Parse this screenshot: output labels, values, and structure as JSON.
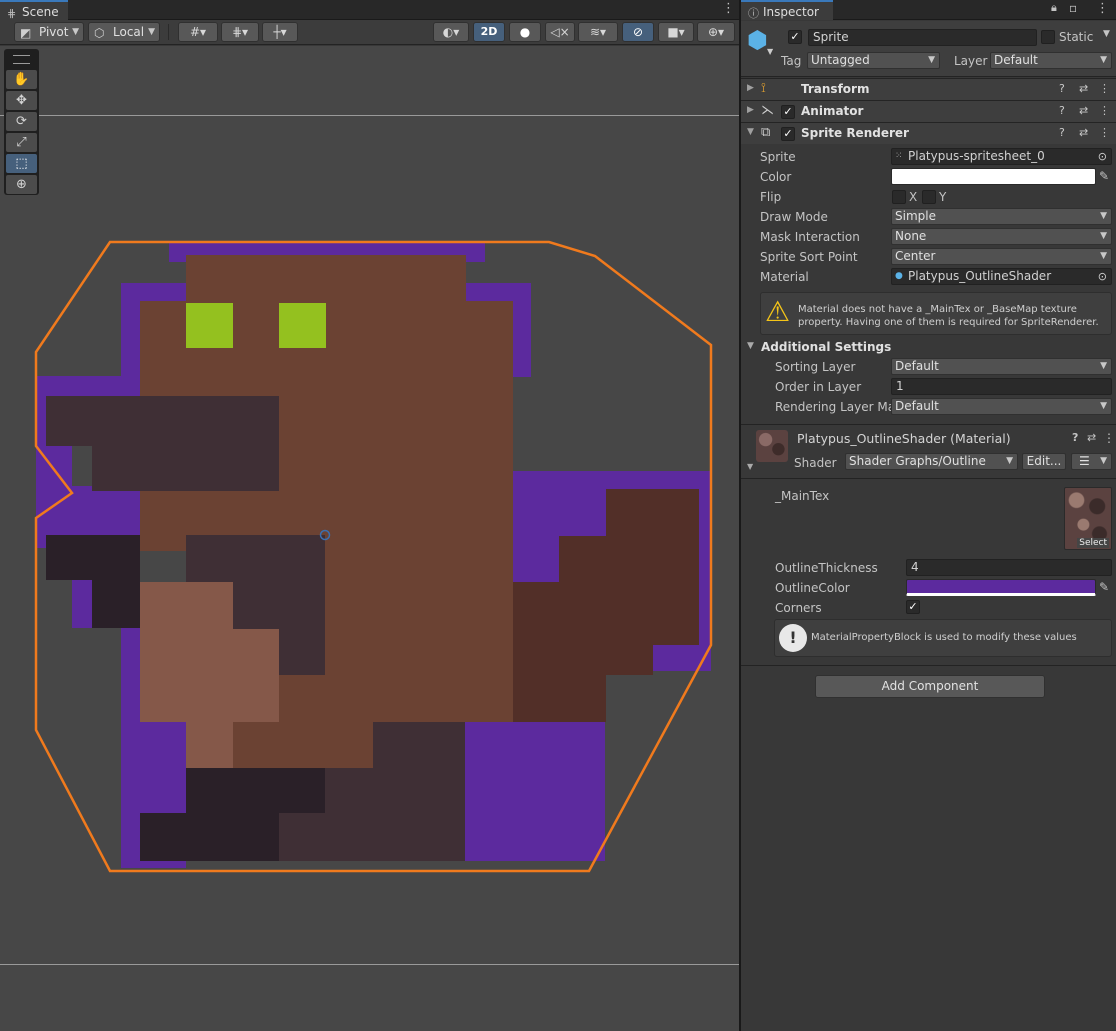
{
  "scene": {
    "tab": "Scene",
    "toolbar": {
      "pivot": "Pivot",
      "local": "Local",
      "mode_2d": "2D"
    },
    "tools": [
      {
        "name": "hand-tool",
        "icon": "✋",
        "active": false
      },
      {
        "name": "move-tool",
        "icon": "✥",
        "active": false
      },
      {
        "name": "rotate-tool",
        "icon": "⟳",
        "active": false
      },
      {
        "name": "scale-tool",
        "icon": "⤢",
        "active": false
      },
      {
        "name": "rect-tool",
        "icon": "⬚",
        "active": true
      },
      {
        "name": "transform-tool",
        "icon": "⊕",
        "active": false
      }
    ],
    "colors": {
      "outline_purple": "#5c2a9e",
      "body": "#6b4233",
      "dark_face": "#3f2f35",
      "darkest": "#2a2028",
      "light": "#855849",
      "tail": "#522f28",
      "eyes": "#94c11f",
      "selection": "#f07a1d"
    }
  },
  "inspector": {
    "tab": "Inspector",
    "object_name": "Sprite",
    "static_label": "Static",
    "tag_label": "Tag",
    "tag_value": "Untagged",
    "layer_label": "Layer",
    "layer_value": "Default",
    "components": {
      "transform": "Transform",
      "animator": "Animator",
      "sprite_renderer": "Sprite Renderer"
    },
    "sprite_renderer": {
      "sprite_label": "Sprite",
      "sprite_value": "Platypus-spritesheet_0",
      "color_label": "Color",
      "color_value": "#ffffff",
      "flip_label": "Flip",
      "flip_x": "X",
      "flip_y": "Y",
      "draw_mode_label": "Draw Mode",
      "draw_mode_value": "Simple",
      "mask_label": "Mask Interaction",
      "mask_value": "None",
      "sort_point_label": "Sprite Sort Point",
      "sort_point_value": "Center",
      "material_label": "Material",
      "material_value": "Platypus_OutlineShader",
      "warning": "Material does not have a _MainTex or _BaseMap texture property. Having one of them is required for SpriteRenderer."
    },
    "additional": {
      "title": "Additional Settings",
      "sorting_layer_label": "Sorting Layer",
      "sorting_layer_value": "Default",
      "order_label": "Order in Layer",
      "order_value": "1",
      "rendering_label": "Rendering Layer Ma",
      "rendering_value": "Default"
    },
    "material": {
      "title": "Platypus_OutlineShader (Material)",
      "shader_label": "Shader",
      "shader_value": "Shader Graphs/Outline",
      "edit_label": "Edit...",
      "maintex_label": "_MainTex",
      "select_label": "Select",
      "thickness_label": "OutlineThickness",
      "thickness_value": "4",
      "outline_color_label": "OutlineColor",
      "outline_color_value": "#5c2a9e",
      "corners_label": "Corners",
      "info": "MaterialPropertyBlock is used to modify these values"
    },
    "add_component": "Add Component"
  }
}
